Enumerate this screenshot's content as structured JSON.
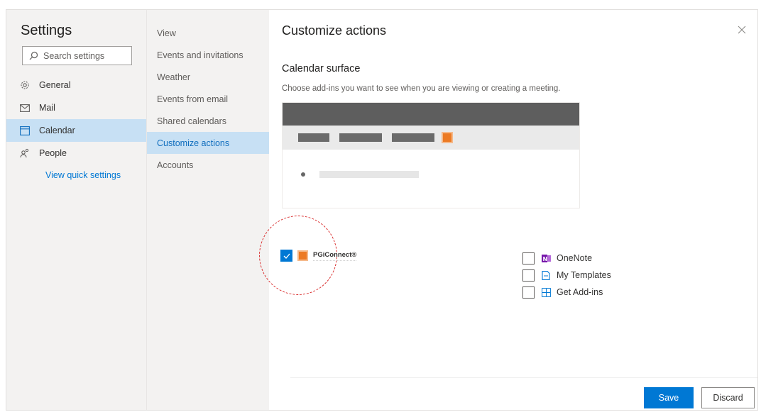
{
  "settings": {
    "title": "Settings",
    "search_placeholder": "Search settings",
    "nav": [
      {
        "label": "General",
        "icon": "gear-icon"
      },
      {
        "label": "Mail",
        "icon": "mail-icon"
      },
      {
        "label": "Calendar",
        "icon": "calendar-icon",
        "active": true
      },
      {
        "label": "People",
        "icon": "people-icon"
      }
    ],
    "quick_settings_label": "View quick settings"
  },
  "subnav": {
    "items": [
      {
        "label": "View"
      },
      {
        "label": "Events and invitations"
      },
      {
        "label": "Weather"
      },
      {
        "label": "Events from email"
      },
      {
        "label": "Shared calendars"
      },
      {
        "label": "Customize actions",
        "active": true
      },
      {
        "label": "Accounts"
      }
    ]
  },
  "main": {
    "title": "Customize actions",
    "section_title": "Calendar surface",
    "section_desc": "Choose add-ins you want to see when you are viewing or creating a meeting.",
    "featured_addin": {
      "label": "PGiConnect®",
      "checked": true
    },
    "addins": [
      {
        "label": "OneNote",
        "icon": "onenote-icon",
        "checked": false
      },
      {
        "label": "My Templates",
        "icon": "templates-icon",
        "checked": false
      },
      {
        "label": "Get Add-ins",
        "icon": "add-ins-icon",
        "checked": false
      }
    ],
    "save_label": "Save",
    "discard_label": "Discard"
  },
  "colors": {
    "accent": "#0078d4",
    "active_bg": "#c7e0f4",
    "addin_orange": "#ec7a24",
    "highlight_circle": "#d92b2b"
  }
}
